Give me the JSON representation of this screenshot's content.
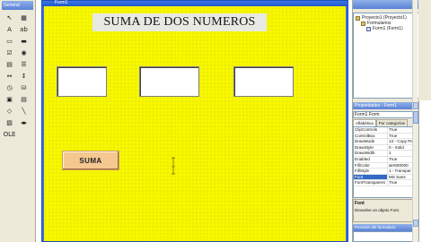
{
  "toolbox": {
    "title": "General",
    "tools": [
      {
        "name": "pointer",
        "glyph": "↖"
      },
      {
        "name": "picture",
        "glyph": "▦"
      },
      {
        "name": "label",
        "glyph": "A"
      },
      {
        "name": "textbox",
        "glyph": "ab"
      },
      {
        "name": "frame",
        "glyph": "▭"
      },
      {
        "name": "command-button",
        "glyph": "▬"
      },
      {
        "name": "checkbox",
        "glyph": "☑"
      },
      {
        "name": "option-button",
        "glyph": "◉"
      },
      {
        "name": "combobox",
        "glyph": "▤"
      },
      {
        "name": "listbox",
        "glyph": "☰"
      },
      {
        "name": "hscrollbar",
        "glyph": "↔"
      },
      {
        "name": "vscrollbar",
        "glyph": "↕"
      },
      {
        "name": "timer",
        "glyph": "◷"
      },
      {
        "name": "drivelistbox",
        "glyph": "⛁"
      },
      {
        "name": "dirlistbox",
        "glyph": "▣"
      },
      {
        "name": "filelistbox",
        "glyph": "▤"
      },
      {
        "name": "shape",
        "glyph": "◇"
      },
      {
        "name": "line",
        "glyph": "╲"
      },
      {
        "name": "image",
        "glyph": "▨"
      },
      {
        "name": "data",
        "glyph": "◂▸"
      },
      {
        "name": "ole",
        "glyph": "OLE"
      }
    ]
  },
  "form": {
    "caption": "Form1",
    "background_color": "#f7f700",
    "title_label": "SUMA DE DOS NUMEROS",
    "button_label": "SUMA"
  },
  "project": {
    "items": [
      {
        "label": "Proyecto1 (Proyecto1)",
        "indent": 0
      },
      {
        "label": "Formularios",
        "indent": 1
      },
      {
        "label": "Form1 (Form1)",
        "indent": 2
      }
    ]
  },
  "properties": {
    "title": "Propiedades - Form1",
    "object": "Form1  Form",
    "tabs": [
      "Alfabética",
      "Por categorías"
    ],
    "rows": [
      {
        "key": "ClipControls",
        "value": "True"
      },
      {
        "key": "ControlBox",
        "value": "True"
      },
      {
        "key": "DrawMode",
        "value": "13 - Copy Pe"
      },
      {
        "key": "DrawStyle",
        "value": "0 - Solid"
      },
      {
        "key": "DrawWidth",
        "value": "1"
      },
      {
        "key": "Enabled",
        "value": "True"
      },
      {
        "key": "FillColor",
        "value": "&H000000"
      },
      {
        "key": "FillStyle",
        "value": "1 - Transpar"
      },
      {
        "key": "Font",
        "value": "MS Sans",
        "selected": true
      },
      {
        "key": "FontTransparent",
        "value": "True"
      }
    ],
    "description_name": "Font",
    "description_text": "Devuelve un objeto Font."
  },
  "layout_window": {
    "title": "Posición del formulario"
  }
}
